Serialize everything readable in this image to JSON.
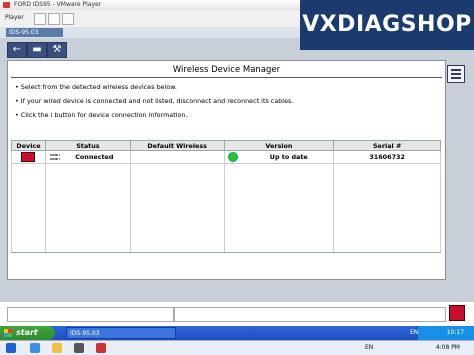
{
  "window": {
    "title": "FORD IDS95 - VMware Player"
  },
  "player": {
    "menu_label": "Player"
  },
  "vm_tab": {
    "label": "IDS-95.03"
  },
  "watermark": {
    "text": "VXDIAGSHOP"
  },
  "ids": {
    "panel_title": "Wireless Device Manager",
    "instructions": [
      "• Select from the detected wireless devices below.",
      "• If your wired device is connected and not listed, disconnect and reconnect its cables.",
      "• Click the i button for device connection information."
    ],
    "table": {
      "headers": [
        "Device",
        "Status",
        "Default Wireless",
        "Version",
        "Serial #"
      ],
      "rows": [
        {
          "status": "Connected",
          "default_wireless": "",
          "version": "Up to date",
          "serial": "31606732"
        }
      ]
    }
  },
  "taskbar": {
    "start_label": "start",
    "task_label": "IDS-95.03",
    "lang": "EN",
    "time": "10:17"
  },
  "host_taskbar": {
    "lang": "EN",
    "time": "4:08 PM"
  },
  "icons": [
    "back-arrow-icon",
    "vcm-device-icon",
    "tools-icon",
    "list-menu-icon",
    "vcm-device-icon"
  ],
  "colors": {
    "ids_background": "#c9cfd9",
    "title_banner": "#1b3a6e",
    "ok_status": "#29c429",
    "start_button": "#3fa63f",
    "xp_taskbar": "#2f64d6"
  }
}
